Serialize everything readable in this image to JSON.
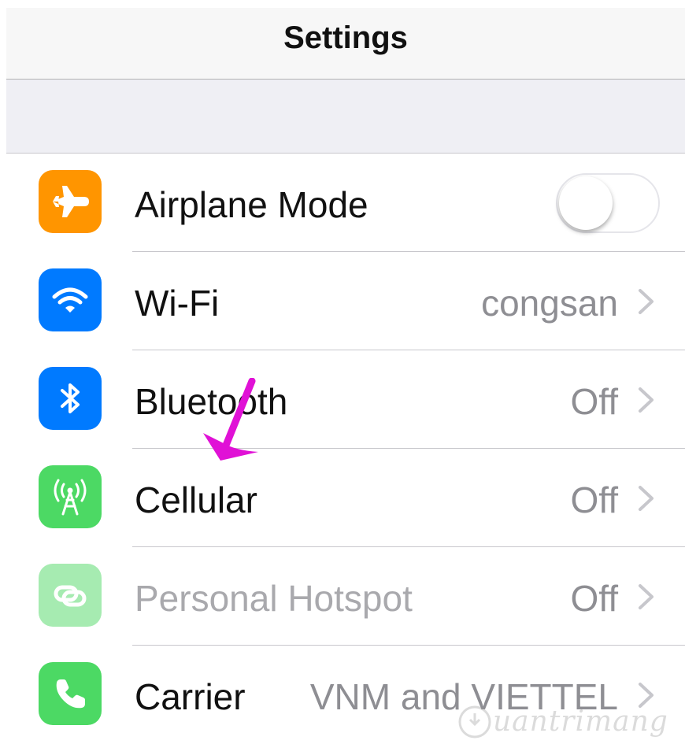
{
  "nav": {
    "title": "Settings"
  },
  "rows": [
    {
      "name": "airplane-mode",
      "label": "Airplane Mode",
      "value": "",
      "icon": "airplane-icon",
      "icon_color": "#ff9500",
      "control": "toggle",
      "toggle_on": false
    },
    {
      "name": "wifi",
      "label": "Wi-Fi",
      "value": "congsan",
      "icon": "wifi-icon",
      "icon_color": "#007aff",
      "control": "chevron"
    },
    {
      "name": "bluetooth",
      "label": "Bluetooth",
      "value": "Off",
      "icon": "bluetooth-icon",
      "icon_color": "#007aff",
      "control": "chevron"
    },
    {
      "name": "cellular",
      "label": "Cellular",
      "value": "Off",
      "icon": "cellular-antenna-icon",
      "icon_color": "#4cd964",
      "control": "chevron"
    },
    {
      "name": "personal-hotspot",
      "label": "Personal Hotspot",
      "value": "Off",
      "icon": "hotspot-link-icon",
      "icon_color": "#a6ebb1",
      "control": "chevron",
      "disabled": true
    },
    {
      "name": "carrier",
      "label": "Carrier",
      "value": "VNM and VIETTEL",
      "icon": "phone-icon",
      "icon_color": "#4cd964",
      "control": "chevron"
    }
  ],
  "annotation": {
    "arrow_color": "#e011d6",
    "points_to": "cellular"
  },
  "watermark": {
    "text": "uantrimang"
  }
}
